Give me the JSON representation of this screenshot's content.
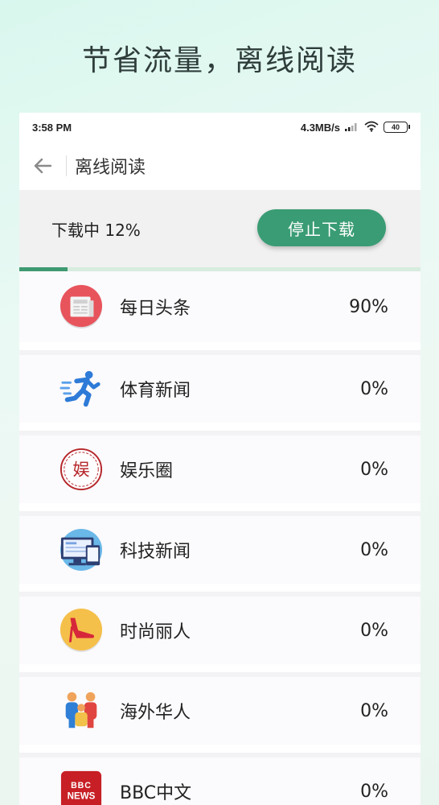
{
  "promo": {
    "headline": "节省流量，离线阅读"
  },
  "status_bar": {
    "time": "3:58 PM",
    "network_speed": "4.3MB/s",
    "battery": "40"
  },
  "app_bar": {
    "title": "离线阅读"
  },
  "download": {
    "status_text": "下载中 12%",
    "progress": 0.12,
    "stop_label": "停止下载"
  },
  "channels": [
    {
      "name": "每日头条",
      "percent": "90%",
      "icon": "newspaper-icon"
    },
    {
      "name": "体育新闻",
      "percent": "0%",
      "icon": "runner-icon"
    },
    {
      "name": "娱乐圈",
      "percent": "0%",
      "icon": "entertainment-seal-icon"
    },
    {
      "name": "科技新闻",
      "percent": "0%",
      "icon": "computer-icon"
    },
    {
      "name": "时尚丽人",
      "percent": "0%",
      "icon": "high-heel-icon"
    },
    {
      "name": "海外华人",
      "percent": "0%",
      "icon": "family-icon"
    },
    {
      "name": "BBC中文",
      "percent": "0%",
      "icon": "bbc-news-icon"
    }
  ],
  "colors": {
    "accent": "#3a9c74",
    "progress_track": "#d7ecdf",
    "panel_bg": "#f1f1f1"
  },
  "icon_text": {
    "seal": "娱",
    "bbc_top": "BBC",
    "bbc_bottom": "NEWS"
  }
}
